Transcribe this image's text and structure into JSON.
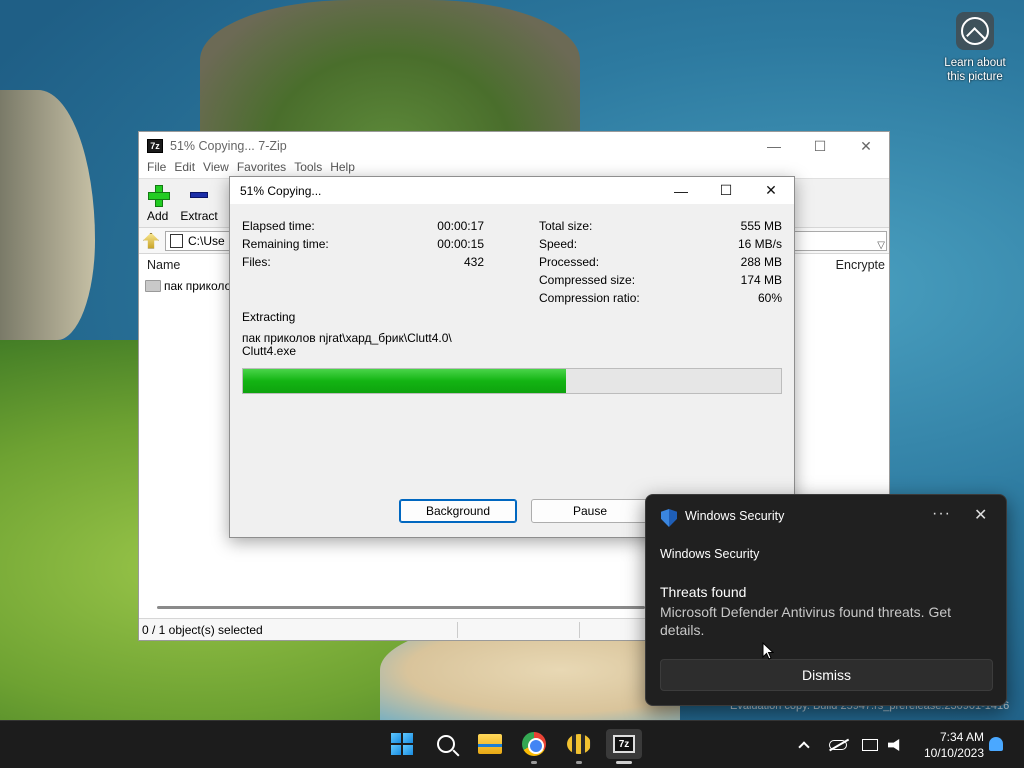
{
  "desktop": {
    "learn_label": "Learn about this picture",
    "watermark": "Evaluation copy. Build 25947.rs_prerelease.230901-1416"
  },
  "zip_window": {
    "title": "51% Copying... 7-Zip",
    "menu": [
      "File",
      "Edit",
      "View",
      "Favorites",
      "Tools",
      "Help"
    ],
    "toolbar": {
      "add_label": "Add",
      "extract_label": "Extract"
    },
    "address": "C:\\Use",
    "columns": {
      "name": "Name",
      "encrypted": "Encrypte"
    },
    "rows": [
      {
        "name": "пак приколо"
      }
    ],
    "status": "0 / 1 object(s) selected"
  },
  "progress_dialog": {
    "title": "51% Copying...",
    "elapsed_label": "Elapsed time:",
    "elapsed_value": "00:00:17",
    "remaining_label": "Remaining time:",
    "remaining_value": "00:00:15",
    "files_label": "Files:",
    "files_value": "432",
    "total_size_label": "Total size:",
    "total_size_value": "555 MB",
    "speed_label": "Speed:",
    "speed_value": "16 MB/s",
    "processed_label": "Processed:",
    "processed_value": "288 MB",
    "compressed_label": "Compressed size:",
    "compressed_value": "174 MB",
    "ratio_label": "Compression ratio:",
    "ratio_value": "60%",
    "operation": "Extracting",
    "path_line1": "пак приколов njrat\\хард_брик\\Clutt4.0\\",
    "path_line2": "Clutt4.exe",
    "progress_fraction": 0.6,
    "background_button": "Background",
    "pause_button": "Pause",
    "progress_color": "#13b413"
  },
  "toast": {
    "app_name": "Windows Security",
    "more_label": "···",
    "close_label": "✕",
    "subtitle": "Windows Security",
    "heading": "Threats found",
    "body": "Microsoft Defender Antivirus found threats. Get details.",
    "dismiss_button": "Dismiss"
  },
  "taskbar": {
    "time": "7:34 AM",
    "date": "10/10/2023",
    "icons": [
      "start-icon",
      "search-icon",
      "file-explorer-icon",
      "chrome-icon",
      "bee-icon",
      "7zip-icon"
    ]
  }
}
